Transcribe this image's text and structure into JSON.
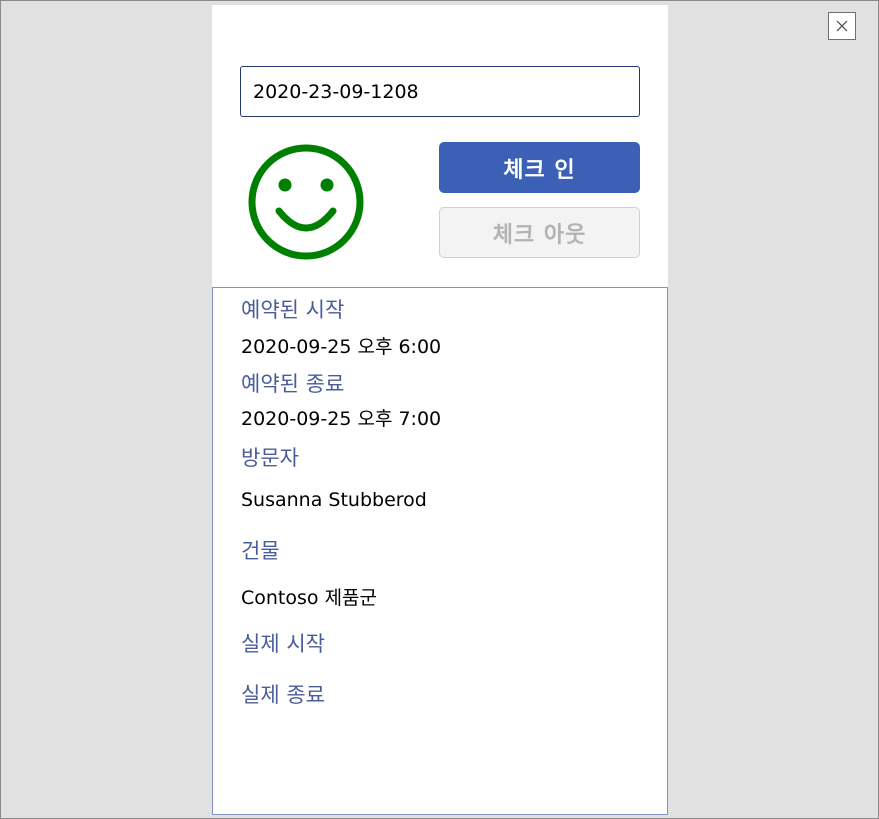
{
  "window": {
    "close_label": "Close",
    "close_icon": "close-icon"
  },
  "visit_id": {
    "value": "2020-23-09-1208"
  },
  "status_icon": {
    "name": "smiley-icon",
    "color": "#008000"
  },
  "buttons": {
    "check_in": "체크 인",
    "check_out": "체크 아웃"
  },
  "details": {
    "scheduled_start_label": "예약된 시작",
    "scheduled_start_value": "2020-09-25 오후 6:00",
    "scheduled_end_label": "예약된 종료",
    "scheduled_end_value": "2020-09-25 오후 7:00",
    "visitor_label": "방문자",
    "visitor_value": "Susanna Stubberod",
    "building_label": "건물",
    "building_value": "Contoso 제품군",
    "actual_start_label": "실제 시작",
    "actual_end_label": "실제 종료"
  },
  "colors": {
    "accent": "#3d60b7",
    "label": "#4a5d9b",
    "success": "#008000",
    "disabled": "#b3b3b3"
  }
}
